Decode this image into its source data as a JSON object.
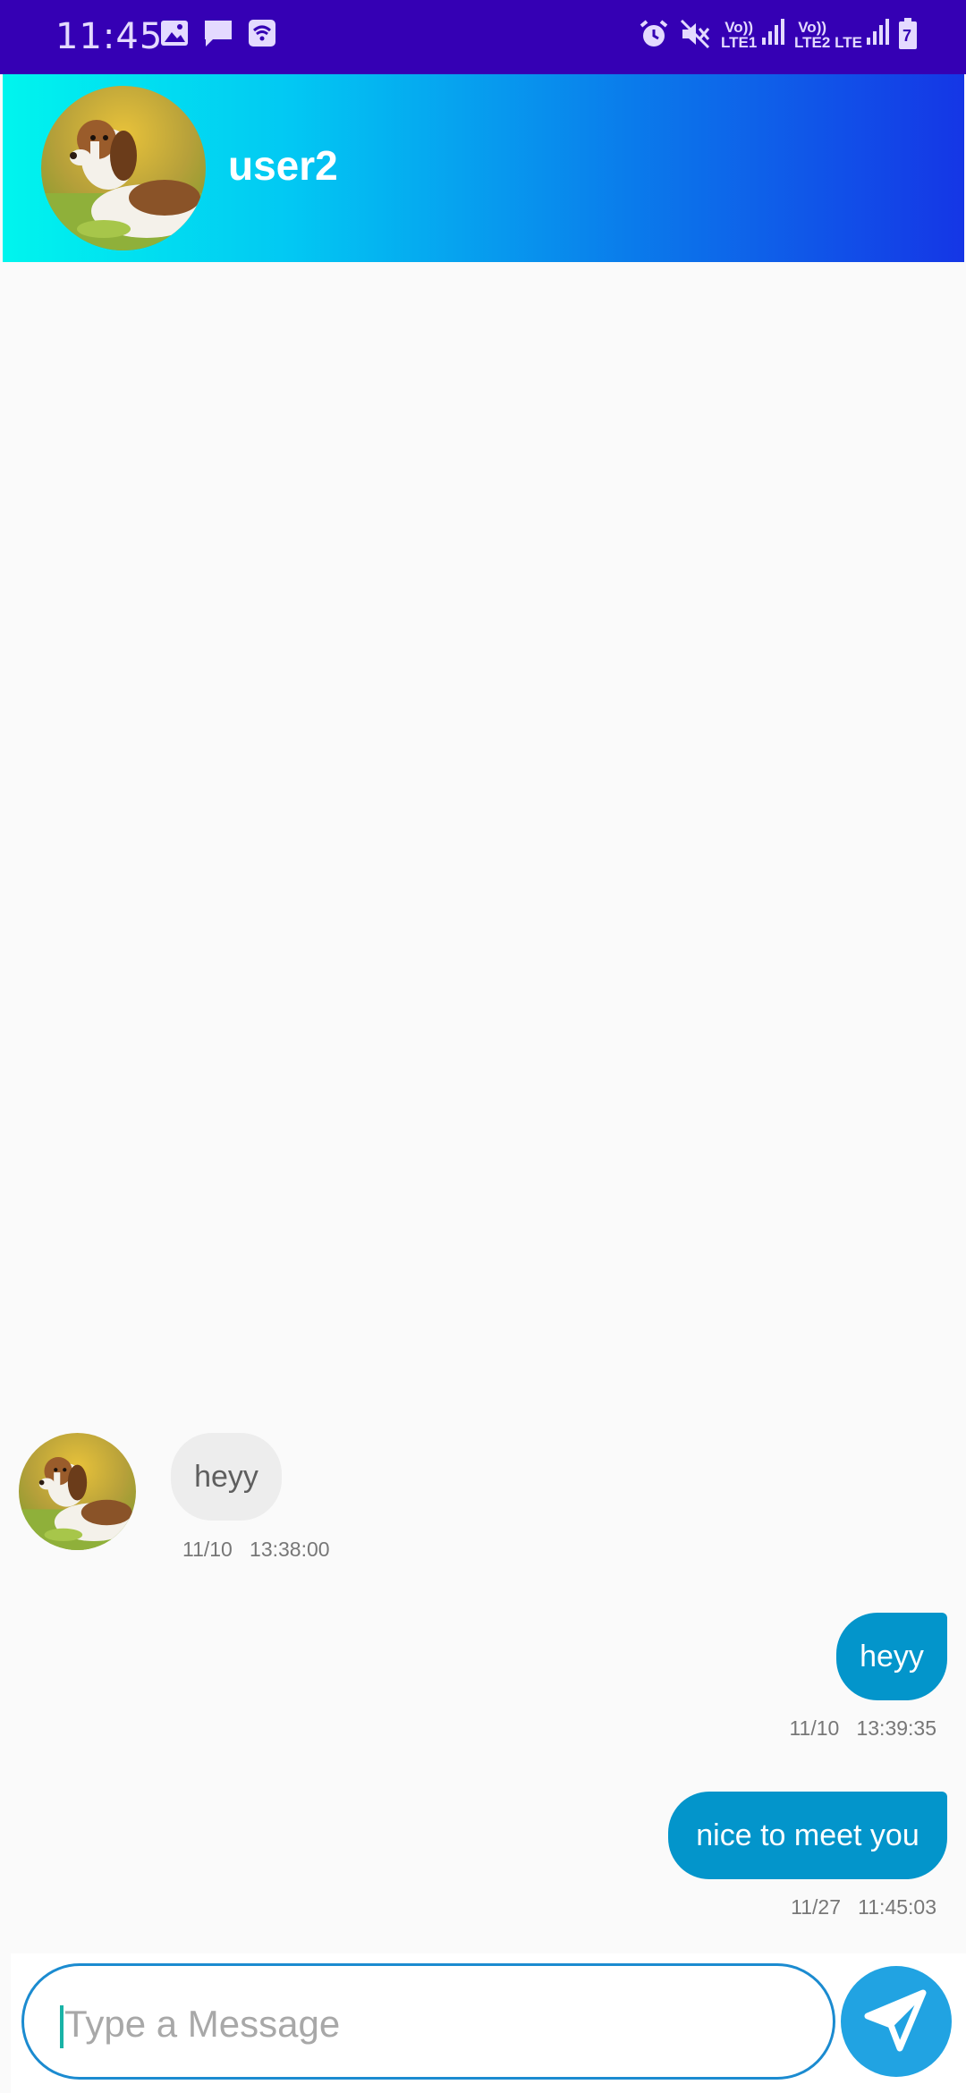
{
  "status_bar": {
    "time": "11:45",
    "left_icons": [
      "image-icon",
      "message-icon",
      "wifi-icon"
    ],
    "right_icons": [
      "alarm-icon",
      "mute-icon",
      "signal-icon",
      "battery-icon"
    ],
    "sim1_label": "Vo)) LTE1",
    "sim2_label": "Vo)) LTE2",
    "data_label": "LTE",
    "battery_level": "7"
  },
  "header": {
    "contact_name": "user2",
    "avatar": "beagle-photo",
    "gradient": [
      "#00F5EE",
      "#1536E6"
    ]
  },
  "messages": [
    {
      "direction": "incoming",
      "text": "heyy",
      "date": "11/10",
      "time": "13:38:00",
      "avatar": "beagle-photo"
    },
    {
      "direction": "outgoing",
      "text": "heyy",
      "date": "11/10",
      "time": "13:39:35"
    },
    {
      "direction": "outgoing",
      "text": "nice to meet you",
      "date": "11/27",
      "time": "11:45:03"
    }
  ],
  "composer": {
    "placeholder": "Type a Message",
    "send_icon": "send-icon"
  },
  "colors": {
    "status_bar": "#3500B4",
    "outgoing_bubble": "#0395CB",
    "incoming_bubble": "#EDEDED",
    "send_button": "#21A3E2",
    "input_border": "#1B8BD0"
  }
}
